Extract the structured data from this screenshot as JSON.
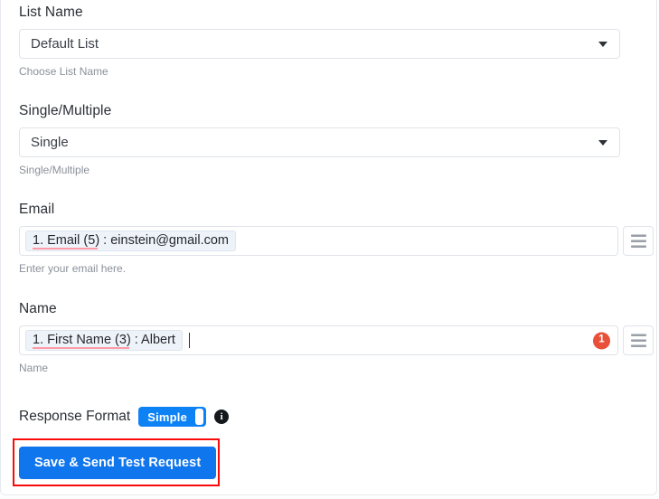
{
  "form": {
    "fields": [
      {
        "label": "List Name",
        "type": "select",
        "value": "Default List",
        "helper": "Choose List Name"
      },
      {
        "label": "Single/Multiple",
        "type": "select",
        "value": "Single",
        "helper": "Single/Multiple"
      },
      {
        "label": "Email",
        "type": "token-input",
        "token_prefix": "1. Email (5",
        "token_suffix": ") : einstein@gmail.com",
        "helper": "Enter your email here.",
        "badge": "",
        "menu_icon": "hamburger-icon"
      },
      {
        "label": "Name",
        "type": "token-input",
        "token_prefix": "1. First Name (3",
        "token_suffix": ") : Albert",
        "helper": "Name",
        "badge": "1",
        "menu_icon": "hamburger-icon"
      }
    ],
    "response_format": {
      "label": "Response Format",
      "toggle_value": "Simple",
      "info_icon": "info-icon",
      "info_glyph": "i"
    },
    "submit_button": "Save & Send Test Request"
  },
  "colors": {
    "primary_blue": "#1076ed",
    "toggle_blue": "#0d82f5",
    "badge_red": "#e8503a",
    "annotation_red": "#fa0a0a",
    "spellcheck_underline": "#ff9aa8",
    "token_background": "#eef3f9",
    "border_gray": "#dfe3e8",
    "helper_gray": "#8a9099",
    "label_dark": "#2b2f36"
  }
}
